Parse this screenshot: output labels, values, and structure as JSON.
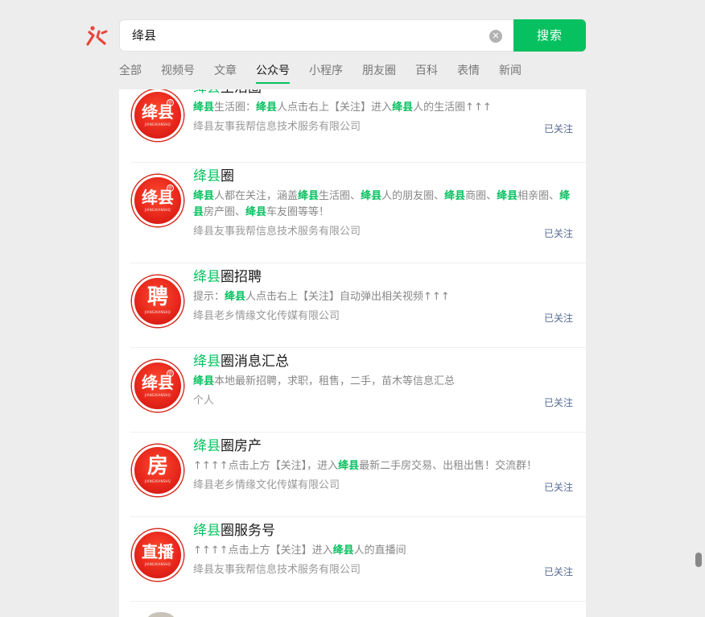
{
  "search": {
    "query": "绛县",
    "button_label": "搜索"
  },
  "tabs": [
    "全部",
    "视频号",
    "文章",
    "公众号",
    "小程序",
    "朋友圈",
    "百科",
    "表情",
    "新闻"
  ],
  "active_tab": "公众号",
  "results": [
    {
      "avatar_text": "绛县",
      "avatar_sub": "JIANGXIANSHQ",
      "title_hl": "绛县",
      "title_rest": "生活圈",
      "desc": [
        [
          "hl",
          "绛县"
        ],
        [
          "",
          "生活圈："
        ],
        [
          "hl",
          "绛县"
        ],
        [
          "",
          "人点击右上【关注】进入"
        ],
        [
          "hl",
          "绛县"
        ],
        [
          "",
          "人的生活圈↑↑↑"
        ]
      ],
      "account": "绛县友事我帮信息技术服务有限公司",
      "follow": "已关注"
    },
    {
      "avatar_text": "绛县",
      "avatar_sub": "JIANGXIANSHQ",
      "title_hl": "绛县",
      "title_rest": "圈",
      "desc": [
        [
          "hl",
          "绛县"
        ],
        [
          "",
          "人都在关注，涵盖"
        ],
        [
          "hl",
          "绛县"
        ],
        [
          "",
          "生活圈、"
        ],
        [
          "hl",
          "绛县"
        ],
        [
          "",
          "人的朋友圈、"
        ],
        [
          "hl",
          "绛县"
        ],
        [
          "",
          "商圈、"
        ],
        [
          "hl",
          "绛县"
        ],
        [
          "",
          "相亲圈、"
        ],
        [
          "hl",
          "绛县"
        ],
        [
          "",
          "房产圈、"
        ],
        [
          "hl",
          "绛县"
        ],
        [
          "",
          "车友圈等等！"
        ]
      ],
      "account": "绛县友事我帮信息技术服务有限公司",
      "follow": "已关注"
    },
    {
      "avatar_text": "聘",
      "avatar_sub": "JIANGXIANSHQ",
      "title_hl": "绛县",
      "title_rest": "圈招聘",
      "desc": [
        [
          "",
          "提示："
        ],
        [
          "hl",
          "绛县"
        ],
        [
          "",
          "人点击右上【关注】自动弹出相关视频↑↑↑"
        ]
      ],
      "account": "绛县老乡情缘文化传媒有限公司",
      "follow": "已关注"
    },
    {
      "avatar_text": "绛县",
      "avatar_sub": "JIANGXIANSHQ",
      "title_hl": "绛县",
      "title_rest": "圈消息汇总",
      "desc": [
        [
          "hl",
          "绛县"
        ],
        [
          "",
          "本地最新招聘，求职，租售，二手，苗木等信息汇总"
        ]
      ],
      "account": "个人",
      "follow": "已关注"
    },
    {
      "avatar_text": "房",
      "avatar_sub": "JIANGXIANSHQ",
      "title_hl": "绛县",
      "title_rest": "圈房产",
      "desc": [
        [
          "",
          "↑↑↑↑点击上方【关注】，进入"
        ],
        [
          "hl",
          "绛县"
        ],
        [
          "",
          "最新二手房交易、出租出售！交流群！"
        ]
      ],
      "account": "绛县老乡情缘文化传媒有限公司",
      "follow": "已关注"
    },
    {
      "avatar_text": "直播",
      "avatar_sub": "JIANGXIANSHQ",
      "title_hl": "绛县",
      "title_rest": "圈服务号",
      "desc": [
        [
          "",
          "↑↑↑↑点击上方【关注】进入"
        ],
        [
          "hl",
          "绛县"
        ],
        [
          "",
          "人的直播间"
        ]
      ],
      "account": "绛县友事我帮信息技术服务有限公司",
      "follow": "已关注"
    }
  ]
}
